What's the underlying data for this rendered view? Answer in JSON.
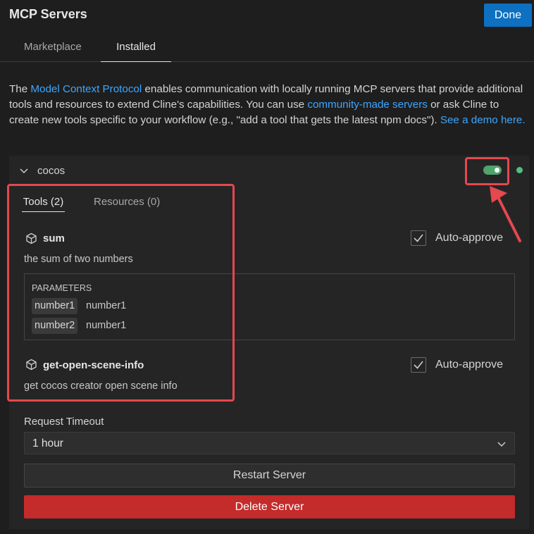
{
  "header": {
    "title": "MCP Servers",
    "done_label": "Done"
  },
  "tabs": [
    {
      "label": "Marketplace"
    },
    {
      "label": "Installed",
      "active": true
    }
  ],
  "intro": {
    "part1": "The ",
    "link1": "Model Context Protocol",
    "part2": " enables communication with locally running MCP servers that provide additional tools and resources to extend Cline's capabilities. You can use ",
    "link2": "community-made servers",
    "part3": " or ask Cline to create new tools specific to your workflow (e.g., \"add a tool that gets the latest npm docs\"). ",
    "link3": "See a demo here."
  },
  "server": {
    "name": "cocos",
    "enabled": true,
    "status_color": "#4fc17a",
    "subtabs": [
      {
        "label": "Tools (2)",
        "active": true
      },
      {
        "label": "Resources (0)"
      }
    ],
    "tools": [
      {
        "name": "sum",
        "icon": "cube-icon",
        "description": "the sum of two numbers",
        "auto_approve_label": "Auto-approve",
        "auto_approve_checked": true,
        "parameters_title": "PARAMETERS",
        "parameters": [
          {
            "name": "number1",
            "description": "number1"
          },
          {
            "name": "number2",
            "description": "number1"
          }
        ]
      },
      {
        "name": "get-open-scene-info",
        "icon": "cube-icon",
        "description": "get cocos creator open scene info",
        "auto_approve_label": "Auto-approve",
        "auto_approve_checked": true
      }
    ],
    "timeout_label": "Request Timeout",
    "timeout_value": "1 hour",
    "restart_label": "Restart Server",
    "delete_label": "Delete Server"
  },
  "colors": {
    "accent": "#0e70c0",
    "link": "#3ea6ff",
    "danger": "#c42b2b",
    "toggle_on": "#4fa36b",
    "annotation": "#e5484d"
  }
}
